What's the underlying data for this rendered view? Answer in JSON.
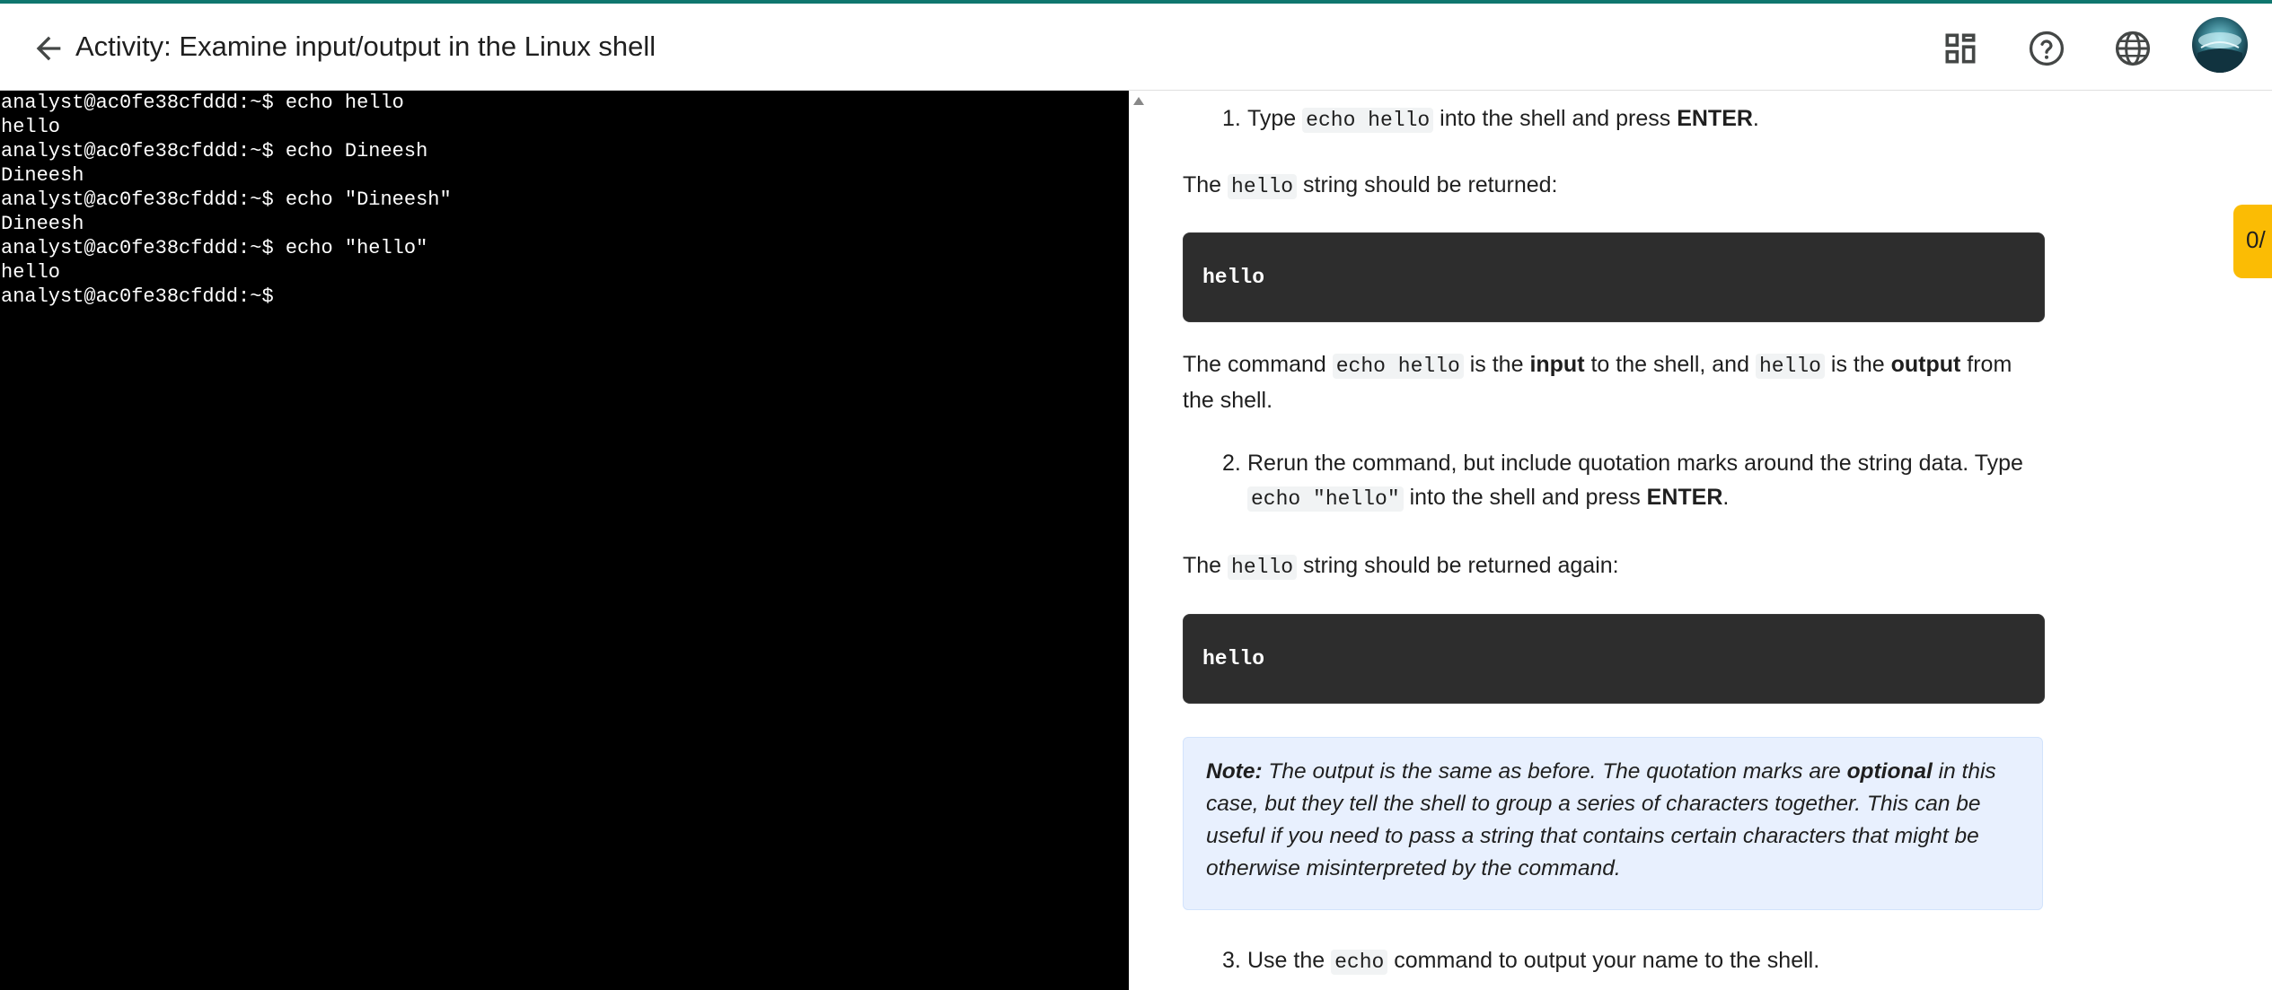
{
  "header": {
    "title": "Activity: Examine input/output in the Linux shell"
  },
  "terminal": {
    "lines": [
      "analyst@ac0fe38cfddd:~$ echo hello",
      "hello",
      "analyst@ac0fe38cfddd:~$ echo Dineesh",
      "Dineesh",
      "analyst@ac0fe38cfddd:~$ echo \"Dineesh\"",
      "Dineesh",
      "analyst@ac0fe38cfddd:~$ echo \"hello\"",
      "hello",
      "analyst@ac0fe38cfddd:~$"
    ]
  },
  "content": {
    "step1": {
      "number": "1.",
      "pre": "Type ",
      "code": "echo hello",
      "mid": " into the shell and press ",
      "key": "ENTER",
      "end": "."
    },
    "p1": {
      "pre": "The ",
      "code": "hello",
      "post": " string should be returned:"
    },
    "code1": "hello",
    "p2": {
      "pre": "The command ",
      "code1": "echo hello",
      "mid1": " is the ",
      "bold1": "input",
      "mid2": " to the shell, and ",
      "code2": "hello",
      "mid3": " is the ",
      "bold2": "output",
      "post": " from the shell."
    },
    "step2": {
      "number": "2.",
      "pre": "Rerun the command, but include quotation marks around the string data. Type ",
      "code": "echo \"hello\"",
      "mid": " into the shell and press ",
      "key": "ENTER",
      "end": "."
    },
    "p3": {
      "pre": "The ",
      "code": "hello",
      "post": " string should be returned again:"
    },
    "code2": "hello",
    "note": {
      "label": "Note:",
      "pre": " The output is the same as before. The quotation marks are ",
      "bold": "optional",
      "post": " in this case, but they tell the shell to group a series of characters together. This can be useful if you need to pass a string that contains certain characters that might be otherwise misinterpreted by the command."
    },
    "step3": {
      "number": "3.",
      "pre": "Use the ",
      "code": "echo",
      "post": " command to output your name to the shell."
    }
  },
  "side_tab": {
    "label": "0/"
  },
  "colors": {
    "accent_line": "#0f766e",
    "terminal_bg": "#000000",
    "code_block_bg": "#2d2d2d",
    "note_bg": "#e8f0fe",
    "side_tab": "#fbbc04"
  },
  "icons": [
    "back-arrow-icon",
    "dashboard-icon",
    "help-icon",
    "globe-icon",
    "user-avatar",
    "scroll-up-arrow-icon"
  ]
}
